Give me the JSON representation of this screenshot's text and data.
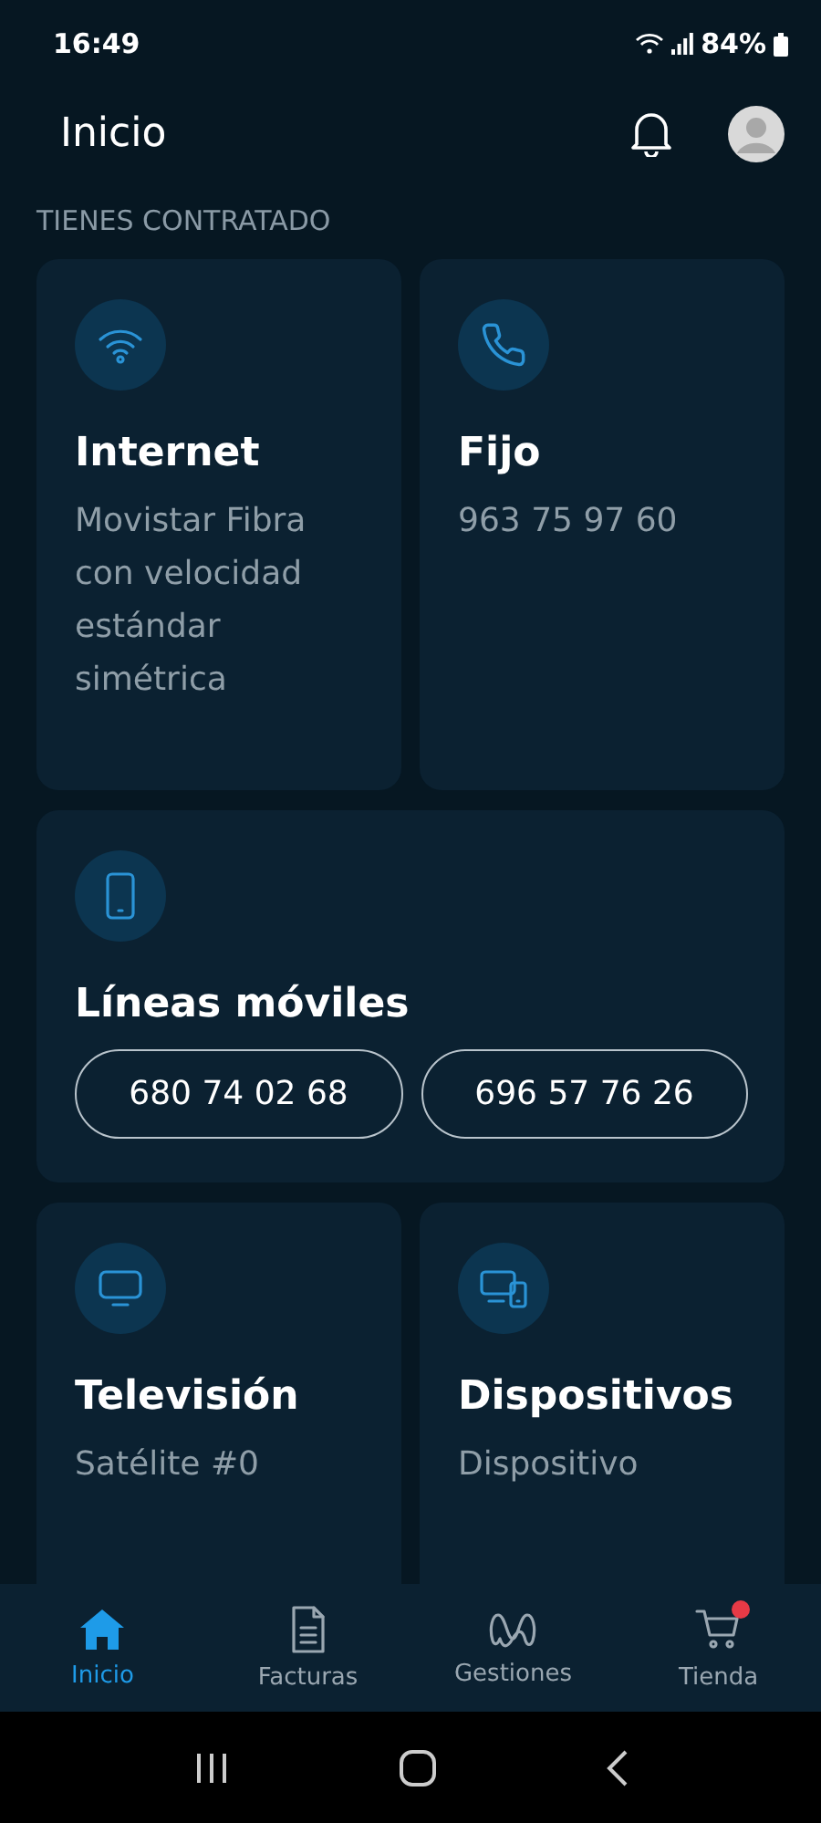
{
  "status_bar": {
    "time": "16:49",
    "battery": "84%"
  },
  "header": {
    "title": "Inicio"
  },
  "section_title": "TIENES CONTRATADO",
  "cards": [
    {
      "kind": "internet",
      "title": "Internet",
      "subtitle": "Movistar Fibra con velocidad estándar simétrica"
    },
    {
      "kind": "landline",
      "title": "Fijo",
      "subtitle": "963 75 97 60"
    },
    {
      "kind": "mobile",
      "title": "Líneas móviles",
      "numbers": [
        "680 74 02 68",
        "696 57 76 26"
      ]
    },
    {
      "kind": "tv",
      "title": "Televisión",
      "subtitle": "Satélite #0"
    },
    {
      "kind": "devices",
      "title": "Dispositivos",
      "subtitle": "Dispositivo"
    }
  ],
  "bottom_nav": [
    {
      "kind": "home",
      "label": "Inicio",
      "selected": true,
      "badge": false
    },
    {
      "kind": "bills",
      "label": "Facturas",
      "selected": false,
      "badge": false
    },
    {
      "kind": "services",
      "label": "Gestiones",
      "selected": false,
      "badge": false
    },
    {
      "kind": "shop",
      "label": "Tienda",
      "selected": false,
      "badge": true
    }
  ]
}
